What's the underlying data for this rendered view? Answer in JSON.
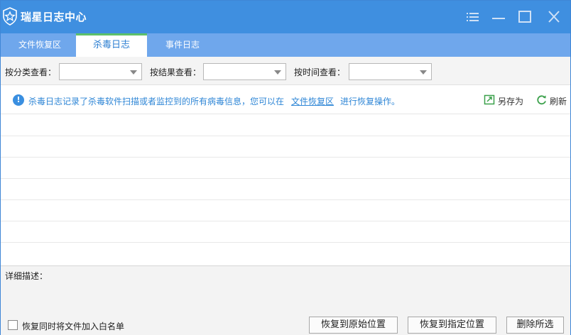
{
  "window": {
    "title": "瑞星日志中心",
    "logo_icon": "star-shield-icon",
    "title_bar_color": "#3f8fe0",
    "controls": [
      {
        "name": "menu-icon"
      },
      {
        "name": "minimize-icon"
      },
      {
        "name": "maximize-icon"
      },
      {
        "name": "close-icon"
      }
    ]
  },
  "tabs": [
    {
      "label": "文件恢复区",
      "active": false
    },
    {
      "label": "杀毒日志",
      "active": true
    },
    {
      "label": "事件日志",
      "active": false
    }
  ],
  "filters": [
    {
      "label": "按分类查看：",
      "value": ""
    },
    {
      "label": "按结果查看：",
      "value": ""
    },
    {
      "label": "按时间查看：",
      "value": ""
    }
  ],
  "info": {
    "icon": "info-icon",
    "text_before": "杀毒日志记录了杀毒软件扫描或者监控到的所有病毒信息，您可以在",
    "link": "文件恢复区",
    "text_after": "进行恢复操作。",
    "save_as_label": "另存为",
    "refresh_label": "刷新",
    "accent_color": "#2e86d6"
  },
  "grid": {
    "rows": [
      "",
      "",
      "",
      "",
      "",
      "",
      ""
    ]
  },
  "detail": {
    "label": "详细描述："
  },
  "bottom": {
    "checkbox_label": "恢复同时将文件加入白名单",
    "checkbox_checked": false,
    "buttons": [
      "恢复到原始位置",
      "恢复到指定位置",
      "删除所选"
    ]
  }
}
